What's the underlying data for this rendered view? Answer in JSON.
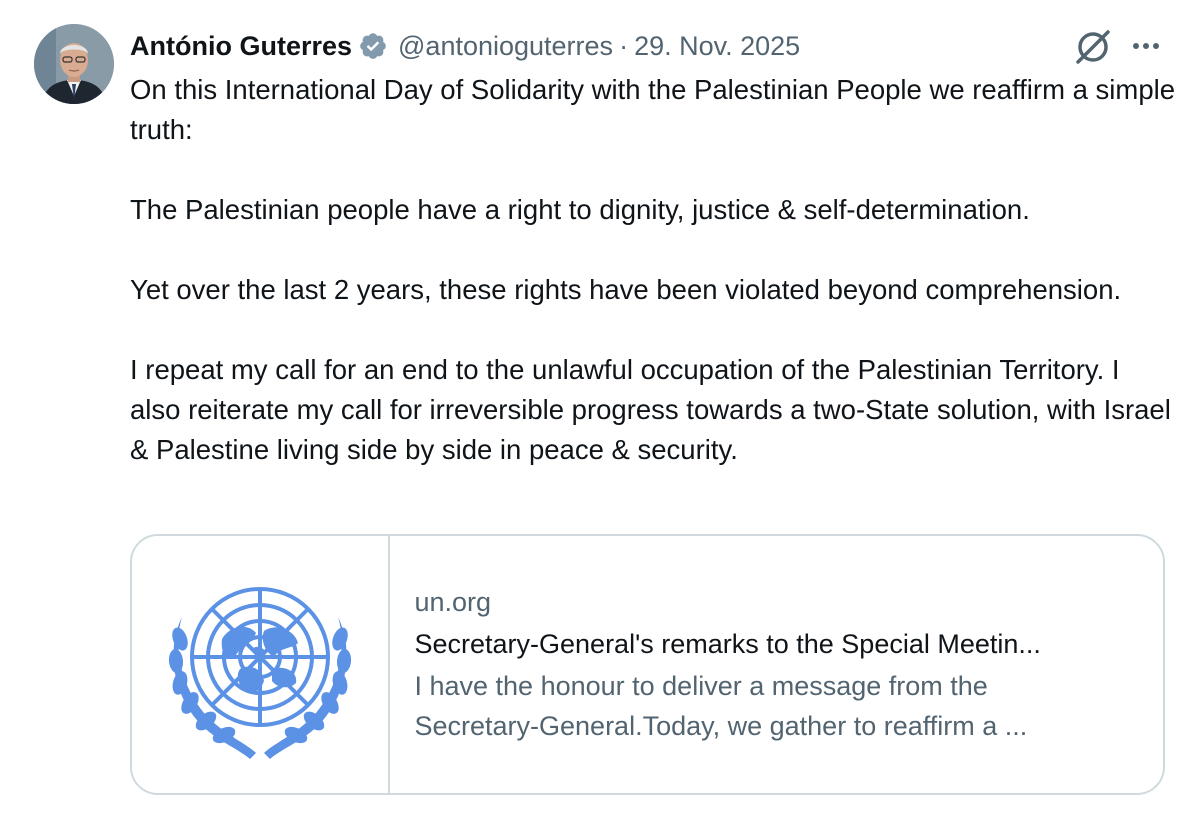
{
  "author": {
    "display_name": "António Guterres",
    "handle": "@antonioguterres",
    "separator": "·",
    "date": "29. Nov. 2025",
    "avatar_icon": "portrait-avatar",
    "verified_icon": "verified-badge-icon"
  },
  "actions": {
    "grok_icon": "grok-icon",
    "more_icon": "more-options-icon"
  },
  "tweet": {
    "paragraphs": [
      "On this International Day of Solidarity with the Palestinian People we reaffirm a simple truth:",
      "The Palestinian people have a right to dignity, justice & self-determination.",
      "Yet over the last 2 years, these rights have been violated beyond comprehension.",
      "I repeat my call for an end to the unlawful occupation of the Palestinian Territory. I also reiterate my call for irreversible progress towards a two-State solution, with Israel & Palestine living side by side in peace & security."
    ]
  },
  "link_card": {
    "domain": "un.org",
    "title": "Secretary-General's remarks to the Special Meetin...",
    "description_line1": "I have the honour to deliver a message from the",
    "description_line2": "Secretary-General.Today, we gather to reaffirm a ...",
    "image_icon": "un-emblem"
  },
  "colors": {
    "text": "#0f1419",
    "secondary_text": "#536471",
    "border": "#cfd9de",
    "verified_badge": "#829aab",
    "un_blue": "#5b92e5"
  }
}
